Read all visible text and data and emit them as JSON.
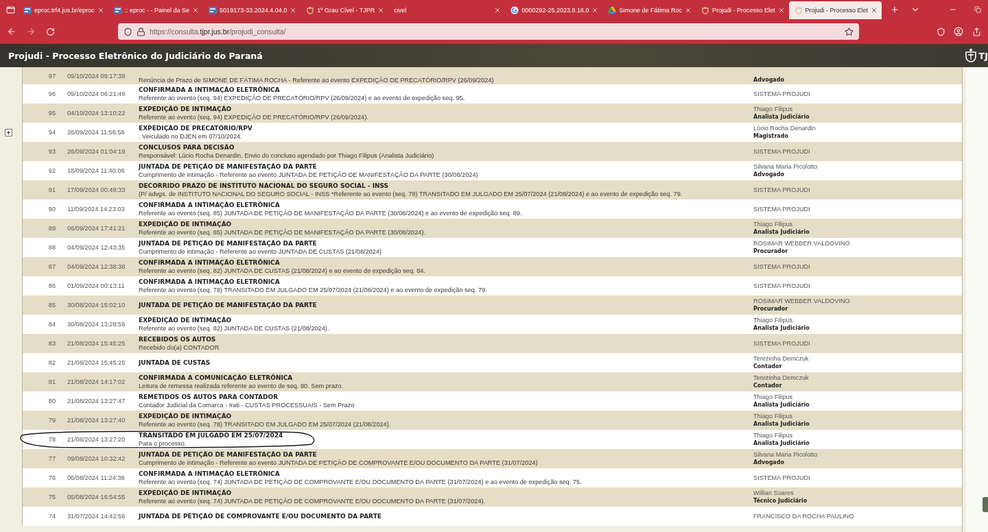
{
  "browser": {
    "tabs": [
      {
        "title": "eproc.trf4.jus.br/eproc",
        "selected": false
      },
      {
        "title": ":: eproc - - Painel da Se",
        "selected": false
      },
      {
        "title": "5019173-33.2024.4.04.0",
        "selected": false
      },
      {
        "title": "1º Grau Cível - TJPR",
        "selected": false
      },
      {
        "title": "civel",
        "selected": false
      },
      {
        "title": "0000292-25.2023.8.16.0",
        "selected": false
      },
      {
        "title": "Simone de Fátima Roc",
        "selected": false
      },
      {
        "title": "Projudi - Processo Elet",
        "selected": false
      },
      {
        "title": "Projudi - Processo Elet",
        "selected": true
      }
    ],
    "url": "https://consulta.**tjpr.jus.br**/projudi_consulta/"
  },
  "header": {
    "title": "Projudi - Processo Eletrônico do Judiciário do Paraná",
    "logo_text": "TJ"
  },
  "rows": [
    {
      "seq": "97",
      "date": "09/10/2024 09:17:38",
      "description": "Renúncia de Prazo de SIMONE DE FÁTIMA ROCHA - Referente ao evento EXPEDIÇÃO DE PRECATÓRIO/RPV (26/09/2024)",
      "role": "Advogado"
    },
    {
      "seq": "96",
      "date": "09/10/2024 06:21:49",
      "title": "CONFIRMADA A INTIMAÇÃO ELETRÔNICA",
      "description": "Referente ao evento (seq. 94) EXPEDIÇÃO DE PRECATÓRIO/RPV (26/09/2024) e ao evento de expedição seq. 95.",
      "actor": "SISTEMA PROJUDI"
    },
    {
      "seq": "95",
      "date": "04/10/2024 13:10:22",
      "title": "EXPEDIÇÃO DE INTIMAÇÃO",
      "description": "Referente ao evento (seq. 94) EXPEDIÇÃO DE PRECATÓRIO/RPV (26/09/2024).",
      "actor": "Thiago Filipus",
      "role": "Analista Judiciário"
    },
    {
      "seq": "94",
      "date": "26/09/2024 11:56:56",
      "title": "EXPEDIÇÃO DE PRECATÓRIO/RPV",
      "description": ". Veiculado no DJEN em 07/10/2024.",
      "actor": "Lúcio Rocha Denardin",
      "role": "Magistrado",
      "expanded": false
    },
    {
      "seq": "93",
      "date": "26/09/2024 01:04:19",
      "title": "CONCLUSOS PARA DECISÃO",
      "description": "Responsável: Lúcio Rocha Denardin. Envio do concluso agendado por Thiago Filipus (Analista Judiciário)",
      "actor": "SISTEMA PROJUDI"
    },
    {
      "seq": "92",
      "date": "18/09/2024 11:40:06",
      "title": "JUNTADA DE PETIÇÃO DE MANIFESTAÇÃO DA PARTE",
      "description": "Cumprimento de intimação - Referente ao evento JUNTADA DE PETIÇÃO DE MANIFESTAÇÃO DA PARTE (30/08/2024)",
      "actor": "Silvana Maria Picolotto",
      "role": "Advogado"
    },
    {
      "seq": "91",
      "date": "17/09/2024 00:49:33",
      "title": "DECORRIDO PRAZO DE INSTITUTO NACIONAL DO SEGURO SOCIAL - INSS",
      "description": "(P/ advgs. de INSTITUTO NACIONAL DO SEGURO SOCIAL - INSS *Referente ao evento (seq. 78) TRANSITADO EM JULGADO EM 25/07/2024 (21/08/2024) e ao evento de expedição seq. 79.",
      "actor": "SISTEMA PROJUDI"
    },
    {
      "seq": "90",
      "date": "11/09/2024 14:23:03",
      "title": "CONFIRMADA A INTIMAÇÃO ELETRÔNICA",
      "description": "Referente ao evento (seq. 85) JUNTADA DE PETIÇÃO DE MANIFESTAÇÃO DA PARTE (30/08/2024) e ao evento de expedição seq. 89.",
      "actor": "SISTEMA PROJUDI"
    },
    {
      "seq": "89",
      "date": "06/09/2024 17:41:21",
      "title": "EXPEDIÇÃO DE INTIMAÇÃO",
      "description": "Referente ao evento (seq. 85) JUNTADA DE PETIÇÃO DE MANIFESTAÇÃO DA PARTE (30/08/2024).",
      "actor": "Thiago Filipus",
      "role": "Analista Judiciário"
    },
    {
      "seq": "88",
      "date": "04/09/2024 12:43:35",
      "title": "JUNTADA DE PETIÇÃO DE MANIFESTAÇÃO DA PARTE",
      "description": "Cumprimento de intimação - Referente ao evento JUNTADA DE CUSTAS (21/08/2024)",
      "actor": "ROSIMAR WEBBER VALDOVINO",
      "role": "Procurador"
    },
    {
      "seq": "87",
      "date": "04/09/2024 12:38:38",
      "title": "CONFIRMADA A INTIMAÇÃO ELETRÔNICA",
      "description": "Referente ao evento (seq. 82) JUNTADA DE CUSTAS (21/08/2024) e ao evento de expedição seq. 84.",
      "actor": "SISTEMA PROJUDI"
    },
    {
      "seq": "86",
      "date": "01/09/2024 00:13:11",
      "title": "CONFIRMADA A INTIMAÇÃO ELETRÔNICA",
      "description": "Referente ao evento (seq. 78) TRANSITADO EM JULGADO EM 25/07/2024 (21/08/2024) e ao evento de expedição seq. 79.",
      "actor": "SISTEMA PROJUDI"
    },
    {
      "seq": "85",
      "date": "30/08/2024 15:02:10",
      "title": "JUNTADA DE PETIÇÃO DE MANIFESTAÇÃO DA PARTE",
      "actor": "ROSIMAR WEBBER VALDOVINO",
      "role": "Procurador"
    },
    {
      "seq": "84",
      "date": "30/08/2024 13:28:56",
      "title": "EXPEDIÇÃO DE INTIMAÇÃO",
      "description": "Referente ao evento (seq. 82) JUNTADA DE CUSTAS (21/08/2024).",
      "actor": "Thiago Filipus",
      "role": "Analista Judiciário"
    },
    {
      "seq": "83",
      "date": "21/08/2024 15:45:25",
      "title": "RECEBIDOS OS AUTOS",
      "description": "Recebido do(a) CONTADOR",
      "actor": "SISTEMA PROJUDI"
    },
    {
      "seq": "82",
      "date": "21/08/2024 15:45:25",
      "title": "JUNTADA DE CUSTAS",
      "actor": "Terezinha Demczuk",
      "role": "Contador"
    },
    {
      "seq": "81",
      "date": "21/08/2024 14:17:02",
      "title": "CONFIRMADA A COMUNICAÇÃO ELETRÔNICA",
      "description": "Leitura de remessa realizada referente ao evento de seq. 80. Sem prazo.",
      "actor": "Terezinha Demczuk",
      "role": "Contador"
    },
    {
      "seq": "80",
      "date": "21/08/2024 13:27:47",
      "title": "REMETIDOS OS AUTOS PARA CONTADOR",
      "description": "Contador Judicial da Comarca - Irati - CUSTAS PROCESSUAIS - Sem Prazo",
      "actor": "Thiago Filipus",
      "role": "Analista Judiciário"
    },
    {
      "seq": "79",
      "date": "21/08/2024 13:27:40",
      "title": "EXPEDIÇÃO DE INTIMAÇÃO",
      "description": "Referente ao evento (seq. 78) TRANSITADO EM JULGADO EM 25/07/2024 (21/08/2024).",
      "actor": "Thiago Filipus",
      "role": "Analista Judiciário"
    },
    {
      "seq": "78",
      "date": "21/08/2024 13:27:20",
      "title": "TRANSITADO EM JULGADO EM 25/07/2024",
      "description": "Para o processo.",
      "actor": "Thiago Filipus",
      "role": "Analista Judiciário",
      "circled": true
    },
    {
      "seq": "77",
      "date": "09/08/2024 10:32:42",
      "title": "JUNTADA DE PETIÇÃO DE MANIFESTAÇÃO DA PARTE",
      "description": "Cumprimento de intimação - Referente ao evento JUNTADA DE PETIÇÃO DE COMPROVANTE E/OU DOCUMENTO DA PARTE (31/07/2024)",
      "actor": "Silvana Maria Picolotto",
      "role": "Advogado"
    },
    {
      "seq": "76",
      "date": "06/08/2024 11:24:38",
      "title": "CONFIRMADA A INTIMAÇÃO ELETRÔNICA",
      "description": "Referente ao evento (seq. 74) JUNTADA DE PETIÇÃO DE COMPROVANTE E/OU DOCUMENTO DA PARTE (31/07/2024) e ao evento de expedição seq. 75.",
      "actor": "SISTEMA PROJUDI"
    },
    {
      "seq": "75",
      "date": "05/08/2024 16:54:55",
      "title": "EXPEDIÇÃO DE INTIMAÇÃO",
      "description": "Referente ao evento (seq. 74) JUNTADA DE PETIÇÃO DE COMPROVANTE E/OU DOCUMENTO DA PARTE (31/07/2024).",
      "actor": "Willian Soares",
      "role": "Técnico Judiciário"
    },
    {
      "seq": "74",
      "date": "31/07/2024 14:42:56",
      "title": "JUNTADA DE PETIÇÃO DE COMPROVANTE E/OU DOCUMENTO DA PARTE",
      "actor": "FRANCISCO DA ROCHA PAULINO"
    }
  ]
}
